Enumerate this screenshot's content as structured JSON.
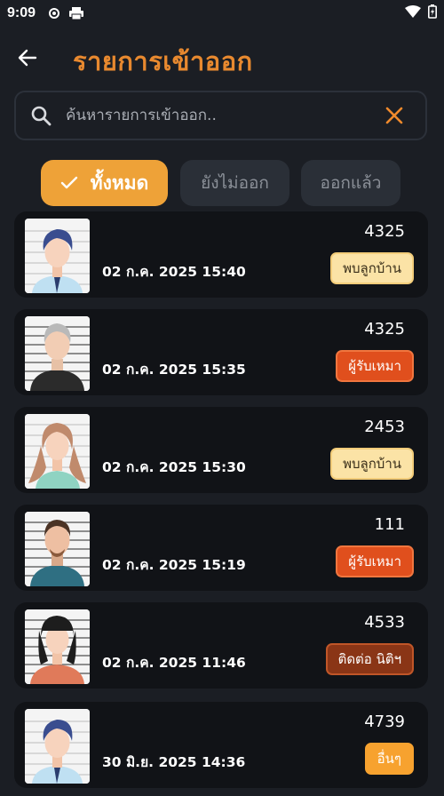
{
  "status_bar": {
    "time": "9:09"
  },
  "header": {
    "title": "รายการเข้าออก"
  },
  "search": {
    "placeholder": "ค้นหารายการเข้าออก.."
  },
  "filters": [
    {
      "label": "ทั้งหมด",
      "active": true
    },
    {
      "label": "ยังไม่ออก",
      "active": false
    },
    {
      "label": "ออกแล้ว",
      "active": false
    }
  ],
  "entries": [
    {
      "datetime": "02 ก.ค. 2025 15:40",
      "number": "4325",
      "status": "พบลูกบ้าน",
      "avatar": "man-blue-hair"
    },
    {
      "datetime": "02 ก.ค. 2025 15:35",
      "number": "4325",
      "status": "ผู้รับเหมา",
      "avatar": "man-gray-hair"
    },
    {
      "datetime": "02 ก.ค. 2025 15:30",
      "number": "2453",
      "status": "พบลูกบ้าน",
      "avatar": "woman-long-hair"
    },
    {
      "datetime": "02 ก.ค. 2025 15:19",
      "number": "111",
      "status": "ผู้รับเหมา",
      "avatar": "man-beard"
    },
    {
      "datetime": "02 ก.ค. 2025 11:46",
      "number": "4533",
      "status": "ติดต่อ นิติฯ",
      "avatar": "woman-black-hair"
    },
    {
      "datetime": "30 มิ.ย. 2025 14:36",
      "number": "4739",
      "status": "อื่นๆ",
      "avatar": "man-blue-hair"
    }
  ],
  "colors": {
    "accent": "#e8892f",
    "chip_active": "#eea238",
    "badge_found": "#fbe3a6",
    "badge_contractor": "#e04f1d",
    "badge_contact": "#8a3516",
    "badge_other": "#f7a22f"
  }
}
